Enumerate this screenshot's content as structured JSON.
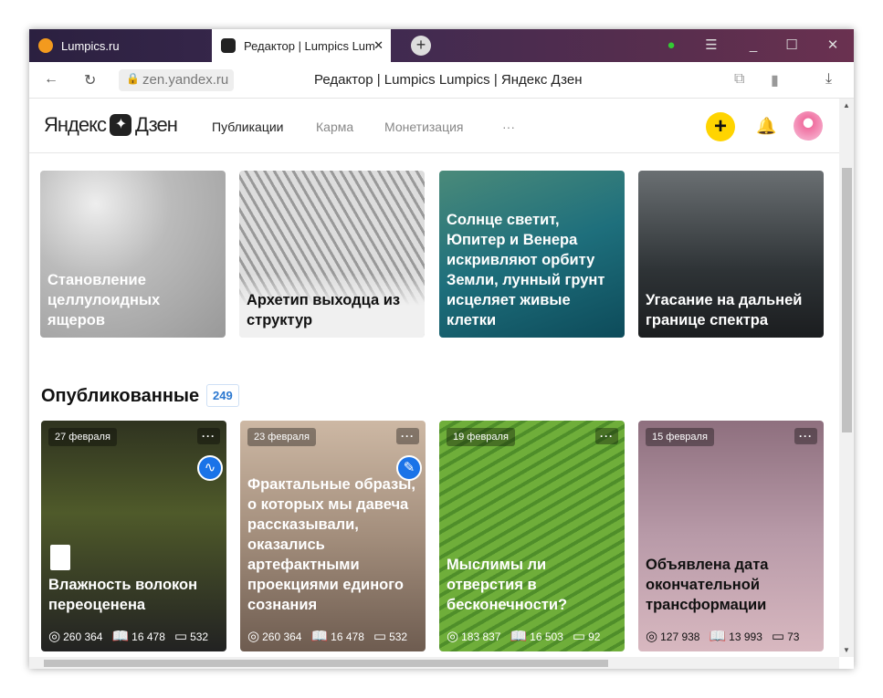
{
  "browser": {
    "tabs": [
      {
        "label": "Lumpics.ru",
        "active": false
      },
      {
        "label": "Редактор | Lumpics Lum",
        "active": true
      }
    ],
    "url": "zen.yandex.ru",
    "page_title": "Редактор | Lumpics Lumpics | Яндекс Дзен"
  },
  "header": {
    "logo_left": "Яндекс",
    "logo_right": "Дзен",
    "nav": [
      "Публикации",
      "Карма",
      "Монетизация",
      "···"
    ],
    "accent": "#ffd400"
  },
  "top_cards": [
    {
      "title": "Становление целлулоидных ящеров"
    },
    {
      "title": "Архетип выходца из структур"
    },
    {
      "title": "Солнце светит, Юпитер и Венера искривляют орбиту Земли, лунный грунт исцеляет живые клетки"
    },
    {
      "title": "Угасание на дальней границе спектра"
    }
  ],
  "published": {
    "title": "Опубликованные",
    "count": "249",
    "cards": [
      {
        "date": "27 февраля",
        "title": "Влажность волокон переоценена",
        "views": "260 364",
        "reads": "16 478",
        "comments": "532",
        "status_icon": "wave-icon"
      },
      {
        "date": "23 февраля",
        "title": "Фрактальные образы, о которых мы давеча рассказывали, оказались артефактными проекциями единого сознания",
        "views": "260 364",
        "reads": "16 478",
        "comments": "532",
        "status_icon": "pencil-icon"
      },
      {
        "date": "19 февраля",
        "title": "Мыслимы ли отверстия в бесконечности?",
        "views": "183 837",
        "reads": "16 503",
        "comments": "92"
      },
      {
        "date": "15 февраля",
        "title": "Объявлена дата окончательной трансформации",
        "views": "127 938",
        "reads": "13 993",
        "comments": "73"
      }
    ]
  }
}
